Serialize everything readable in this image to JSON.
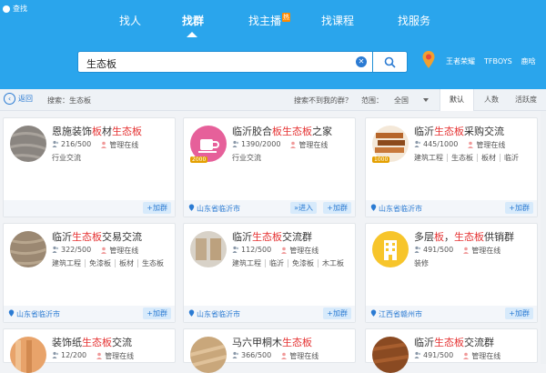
{
  "app": {
    "title": "查找"
  },
  "nav": {
    "items": [
      "找人",
      "找群",
      "找主播",
      "找课程",
      "找服务"
    ],
    "hot_label": "热"
  },
  "search": {
    "value": "生态板"
  },
  "hot_words": [
    "王者荣耀",
    "TFBOYS",
    "鹿晗"
  ],
  "toolbar": {
    "back": "返回",
    "crumb": "搜索：生态板",
    "notfound": "搜索不到我的群？",
    "range_label": "范围：",
    "range_value": "全国",
    "sort": [
      "默认",
      "人数",
      "活跃度"
    ]
  },
  "cards": [
    {
      "pre": "恩施装饰",
      "hl1": "板",
      "mid": "材",
      "hl2": "生态板",
      "post": "",
      "members": "216/500",
      "admin": "管理在线",
      "tags": [
        "行业交流"
      ],
      "loc": "",
      "btns": [
        "+加群"
      ],
      "thumb": "wood-grey"
    },
    {
      "pre": "临沂胶合",
      "hl1": "板",
      "mid": "",
      "hl2": "生态板",
      "post": "之家",
      "members": "1390/2000",
      "admin": "管理在线",
      "tags": [
        "行业交流"
      ],
      "loc": "山东省临沂市",
      "btns": [
        "»进入",
        "+加群"
      ],
      "thumb": "cup",
      "badge": "2000"
    },
    {
      "pre": "临沂",
      "hl1": "",
      "mid": "",
      "hl2": "生态板",
      "post": "采购交流",
      "members": "445/1000",
      "admin": "管理在线",
      "tags": [
        "建筑工程",
        "生态板",
        "板材",
        "临沂"
      ],
      "loc": "山东省临沂市",
      "btns": [
        "+加群"
      ],
      "thumb": "plywood",
      "badge": "1000"
    },
    {
      "pre": "临沂",
      "hl1": "",
      "mid": "",
      "hl2": "生态板",
      "post": "交易交流",
      "members": "322/500",
      "admin": "管理在线",
      "tags": [
        "建筑工程",
        "免漆板",
        "板材",
        "生态板"
      ],
      "loc": "山东省临沂市",
      "btns": [
        "+加群"
      ],
      "thumb": "wood-brown"
    },
    {
      "pre": "临沂",
      "hl1": "",
      "mid": "",
      "hl2": "生态板",
      "post": "交流群",
      "members": "112/500",
      "admin": "管理在线",
      "tags": [
        "建筑工程",
        "临沂",
        "免漆板",
        "木工板"
      ],
      "loc": "山东省临沂市",
      "btns": [
        "+加群"
      ],
      "thumb": "room"
    },
    {
      "pre": "多层",
      "hl1": "板",
      "mid": "，",
      "hl2": "生态板",
      "post": "供销群",
      "members": "491/500",
      "admin": "管理在线",
      "tags": [
        "装修"
      ],
      "loc": "江西省赣州市",
      "btns": [
        "+加群"
      ],
      "thumb": "building"
    },
    {
      "pre": "装饰纸",
      "hl1": "",
      "mid": "",
      "hl2": "生态板",
      "post": "交流",
      "members": "12/200",
      "admin": "管理在线",
      "tags": [],
      "loc": "",
      "btns": [],
      "thumb": "orange"
    },
    {
      "pre": "马六甲桐木",
      "hl1": "",
      "mid": "",
      "hl2": "生态板",
      "post": "",
      "members": "366/500",
      "admin": "管理在线",
      "tags": [],
      "loc": "",
      "btns": [],
      "thumb": "floor"
    },
    {
      "pre": "临沂",
      "hl1": "",
      "mid": "",
      "hl2": "生态板",
      "post": "交流群",
      "members": "491/500",
      "admin": "管理在线",
      "tags": [],
      "loc": "",
      "btns": [],
      "thumb": "darkwood"
    }
  ]
}
